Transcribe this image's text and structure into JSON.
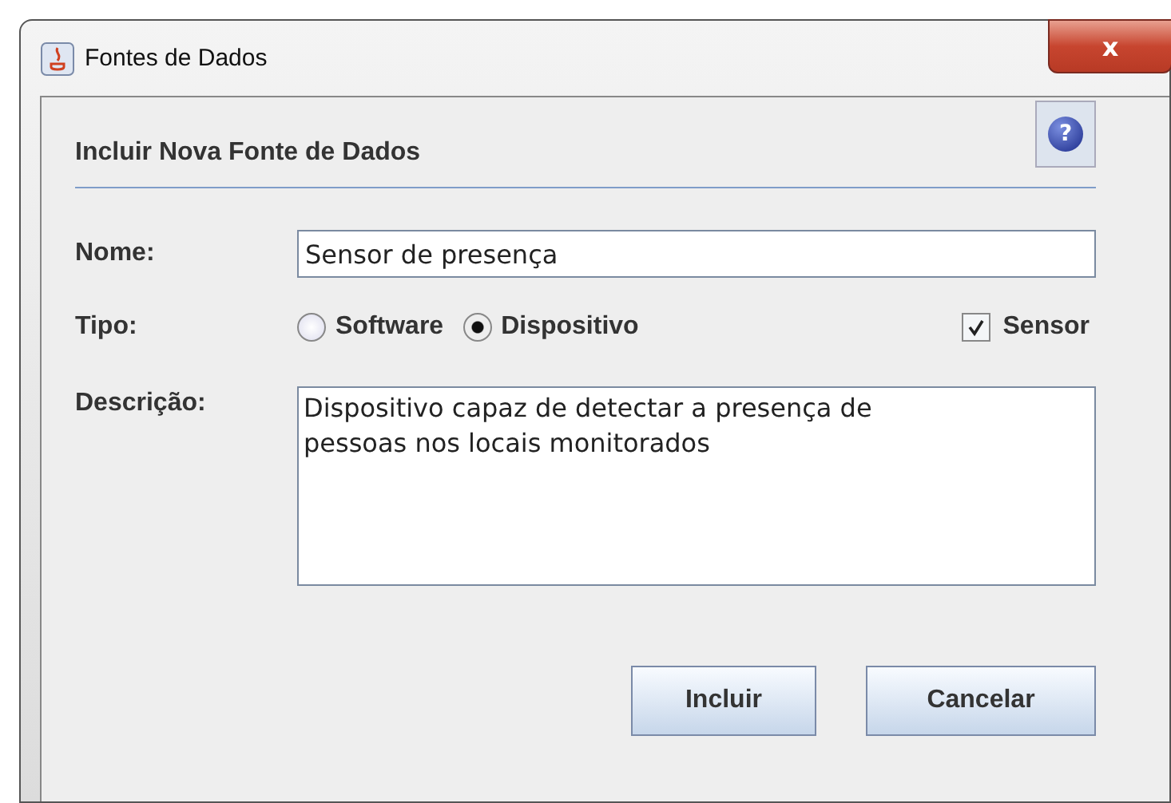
{
  "window": {
    "title": "Fontes de Dados",
    "close": "x"
  },
  "heading": "Incluir Nova Fonte de Dados",
  "help": "?",
  "name": {
    "label": "Nome:",
    "value": "Sensor de presença"
  },
  "type": {
    "label": "Tipo:",
    "options": [
      {
        "label": "Software",
        "selected": false
      },
      {
        "label": "Dispositivo",
        "selected": true
      }
    ],
    "sensor": {
      "label": "Sensor",
      "checked": true
    }
  },
  "description": {
    "label": "Descrição:",
    "value": "Dispositivo capaz de detectar a presença de\npessoas nos locais monitorados"
  },
  "buttons": [
    "Incluir",
    "Cancelar"
  ]
}
